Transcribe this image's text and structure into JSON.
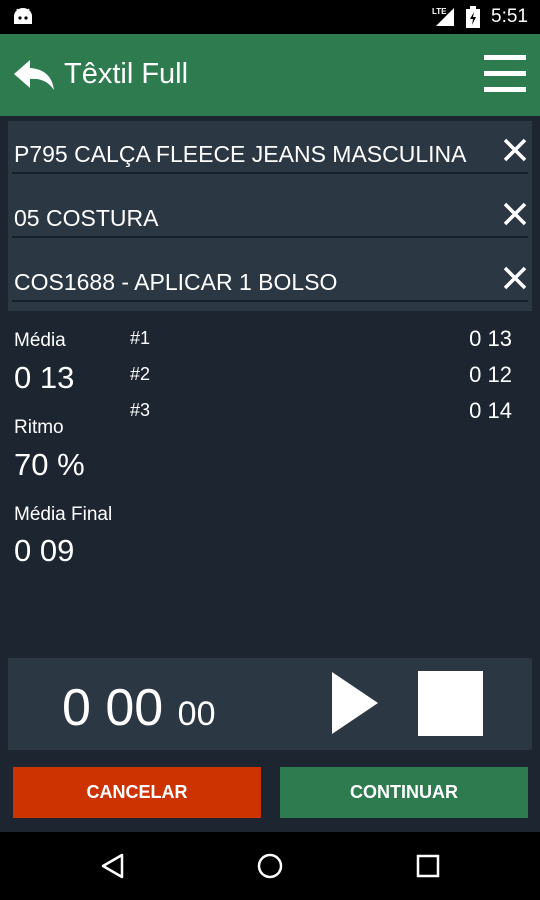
{
  "status_bar": {
    "time": "5:51",
    "network": "LTE"
  },
  "app_bar": {
    "title": "Têxtil Full"
  },
  "fields": [
    {
      "label": "P795 CALÇA FLEECE JEANS MASCULINA"
    },
    {
      "label": "05 COSTURA"
    },
    {
      "label": "COS1688 - APLICAR 1 BOLSO"
    }
  ],
  "stats": {
    "media_label": "Média",
    "media_value": "0 13",
    "ritmo_label": "Ritmo",
    "ritmo_value": "70 %",
    "media_final_label": "Média Final",
    "media_final_value": "0 09"
  },
  "records": [
    {
      "label": "#1",
      "value": "0 13"
    },
    {
      "label": "#2",
      "value": "0 12"
    },
    {
      "label": "#3",
      "value": "0 14"
    }
  ],
  "timer": {
    "main": "0 00",
    "ms": "00"
  },
  "buttons": {
    "cancel": "CANCELAR",
    "continue": "CONTINUAR"
  },
  "colors": {
    "app_bar": "#2e7b4f",
    "background": "#1c2530",
    "panel": "#2c3744",
    "cancel": "#cc3300",
    "continue": "#2e7b4f"
  },
  "icons": [
    "android-icon",
    "signal-icon",
    "battery-icon",
    "back-arrow-icon",
    "menu-icon",
    "close-icon",
    "play-icon",
    "stop-icon",
    "nav-back-icon",
    "nav-home-icon",
    "nav-recents-icon"
  ]
}
